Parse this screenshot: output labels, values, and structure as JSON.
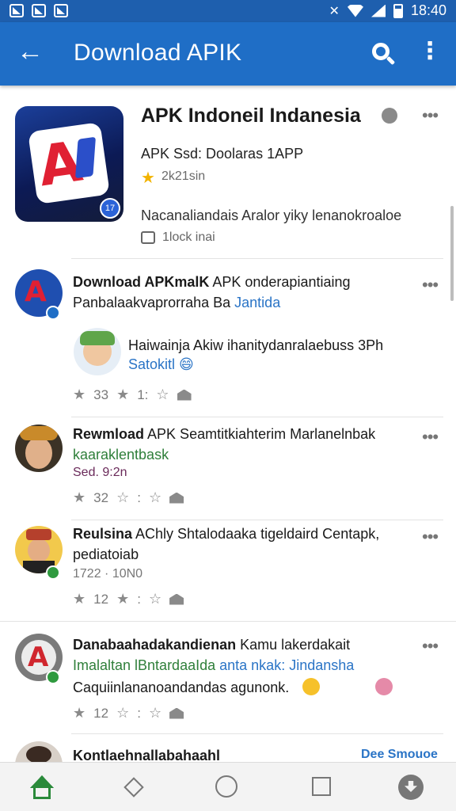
{
  "status_bar": {
    "time": "18:40"
  },
  "app_bar": {
    "title": "Download APIK"
  },
  "featured_app": {
    "name": "APK Indoneil Indanesia",
    "subtitle": "APK Ssd: Doolaras 1APP",
    "rating": "2k21sin",
    "description": "Nacanaliandais Aralor yiky lenanokroaloe",
    "package_info": "1lock inai"
  },
  "posts": [
    {
      "title_bold": "Download APKmalK",
      "title_rest": " APK onderapiantiaing",
      "line2": "Panbalaakvaprorraha Ba",
      "line2_link": "Jantida",
      "quote_text": "Haiwainja Akiw ihanitydanralaebuss 3Ph",
      "quote_link": "Satokitl",
      "meta": [
        "33",
        "1:"
      ]
    },
    {
      "title_bold": "Rewmload",
      "title_rest": " APK Seamtitkiahterim Marlanelnbak",
      "line2_green": "kaaraklentbask",
      "line3": "Sed. 9:2n",
      "meta": [
        "32",
        ":"
      ]
    },
    {
      "title_bold": "Reulsina",
      "title_rest": " AChly Shtalodaaka tigeldaird Centapk,",
      "line2": "pediatoiab",
      "line3": "1722 · 10N0",
      "meta": [
        "12",
        ":"
      ]
    },
    {
      "title_bold": "Danabaahadakandienan",
      "title_rest": " Kamu lakerdakait",
      "line2_green": "Imalaltan lBntardaaIda",
      "line2_link": "anta nkak: Jindansha",
      "line3": "Caquiinlananoandandas agunonk.",
      "meta": [
        "12",
        ":"
      ]
    }
  ],
  "last_post": {
    "title_bold": "Kontlaehnallabahaahl",
    "see_more": "Dee Smouoe"
  },
  "colors": {
    "app_bar": "#1f6ec6",
    "status_bar": "#1e5fae",
    "link": "#2a74c6",
    "green_text": "#2f7f3a",
    "star": "#f2b300"
  }
}
